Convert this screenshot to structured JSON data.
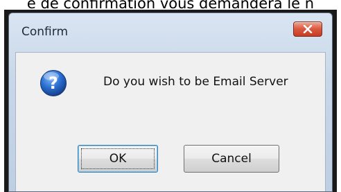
{
  "page_caption": "e de confirmation vous demandera le n",
  "dialog": {
    "title": "Confirm",
    "message": "Do you wish to be Email Server",
    "icon": "question-icon",
    "buttons": {
      "ok_label": "OK",
      "cancel_label": "Cancel"
    },
    "colors": {
      "close_button": "#d9573d",
      "icon_blue": "#1f5fbf",
      "titlebar": "#c7d6e8"
    }
  }
}
